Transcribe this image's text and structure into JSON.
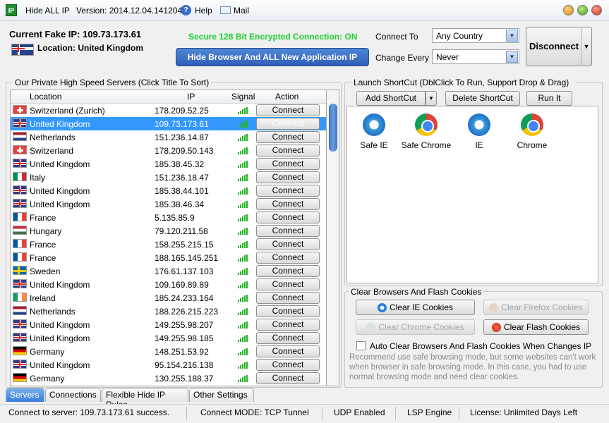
{
  "titlebar": {
    "app_name": "Hide ALL IP",
    "version": "Version: 2014.12.04.141204",
    "help": "Help",
    "mail": "Mail"
  },
  "info": {
    "current_ip": "Current Fake IP: 109.73.173.61",
    "location": "Location: United Kingdom",
    "secure": "Secure 128 Bit Encrypted Connection: ON",
    "hide_button": "Hide Browser And ALL New Application IP"
  },
  "settings": {
    "connect_to_label": "Connect To",
    "connect_to_value": "Any Country",
    "change_every_label": "Change Every",
    "change_every_value": "Never",
    "disconnect": "Disconnect"
  },
  "servers": {
    "title": "Our Private High Speed Servers (Click Title To Sort)",
    "headers": {
      "location": "Location",
      "ip": "IP",
      "signal": "Signal",
      "action": "Action"
    },
    "connect_label": "Connect",
    "rows": [
      {
        "flag": "ch",
        "location": "Switzerland (Zurich)",
        "ip": "178.209.52.25"
      },
      {
        "flag": "uk",
        "location": "United Kingdom",
        "ip": "109.73.173.61",
        "selected": true
      },
      {
        "flag": "nl",
        "location": "Netherlands",
        "ip": "151.236.14.87"
      },
      {
        "flag": "ch",
        "location": "Switzerland",
        "ip": "178.209.50.143"
      },
      {
        "flag": "uk",
        "location": "United Kingdom",
        "ip": "185.38.45.32"
      },
      {
        "flag": "it",
        "location": "Italy",
        "ip": "151.236.18.47"
      },
      {
        "flag": "uk",
        "location": "United Kingdom",
        "ip": "185.38.44.101"
      },
      {
        "flag": "uk",
        "location": "United Kingdom",
        "ip": "185.38.46.34"
      },
      {
        "flag": "fr",
        "location": "France",
        "ip": "5.135.85.9"
      },
      {
        "flag": "hu",
        "location": "Hungary",
        "ip": "79.120.211.58"
      },
      {
        "flag": "fr",
        "location": "France",
        "ip": "158.255.215.15"
      },
      {
        "flag": "fr",
        "location": "France",
        "ip": "188.165.145.251"
      },
      {
        "flag": "se",
        "location": "Sweden",
        "ip": "176.61.137.103"
      },
      {
        "flag": "uk",
        "location": "United Kingdom",
        "ip": "109.169.89.89"
      },
      {
        "flag": "ie",
        "location": "Ireland",
        "ip": "185.24.233.164"
      },
      {
        "flag": "nl",
        "location": "Netherlands",
        "ip": "188.226.215.223"
      },
      {
        "flag": "uk",
        "location": "United Kingdom",
        "ip": "149.255.98.207"
      },
      {
        "flag": "uk",
        "location": "United Kingdom",
        "ip": "149.255.98.185"
      },
      {
        "flag": "de",
        "location": "Germany",
        "ip": "148.251.53.92"
      },
      {
        "flag": "uk",
        "location": "United Kingdom",
        "ip": "95.154.216.138"
      },
      {
        "flag": "de",
        "location": "Germany",
        "ip": "130.255.188.37"
      }
    ]
  },
  "shortcuts": {
    "title": "Launch ShortCut (DblClick To Run, Support Drop & Drag)",
    "add": "Add ShortCut",
    "delete": "Delete ShortCut",
    "run": "Run It",
    "apps": [
      {
        "label": "Safe IE",
        "icon": "ie-icon"
      },
      {
        "label": "Safe Chrome",
        "icon": "chrome-icon"
      },
      {
        "label": "IE",
        "icon": "ie-icon"
      },
      {
        "label": "Chrome",
        "icon": "chrome-icon"
      }
    ]
  },
  "cookies": {
    "title": "Clear Browsers And Flash Cookies",
    "clear_ie": "Clear IE Cookies",
    "clear_firefox": "Clear Firefox Cookies",
    "clear_chrome": "Clear Chrome Cookies",
    "clear_flash": "Clear Flash Cookies",
    "auto_clear": "Auto Clear Browsers And Flash Cookies When Changes IP",
    "note": "Recommend use safe browsing mode, but some websites can't work when browser in safe browsing mode. In this case, you had to use normal browsing mode and need clear cookies."
  },
  "tabs": [
    "Servers",
    "Connections",
    "Flexible Hide IP Rules",
    "Other Settings"
  ],
  "status": {
    "connect": "Connect to server: 109.73.173.61 success.",
    "mode": "Connect MODE: TCP Tunnel",
    "udp": "UDP Enabled",
    "lsp": "LSP Engine",
    "license": "License: Unlimited Days Left"
  }
}
